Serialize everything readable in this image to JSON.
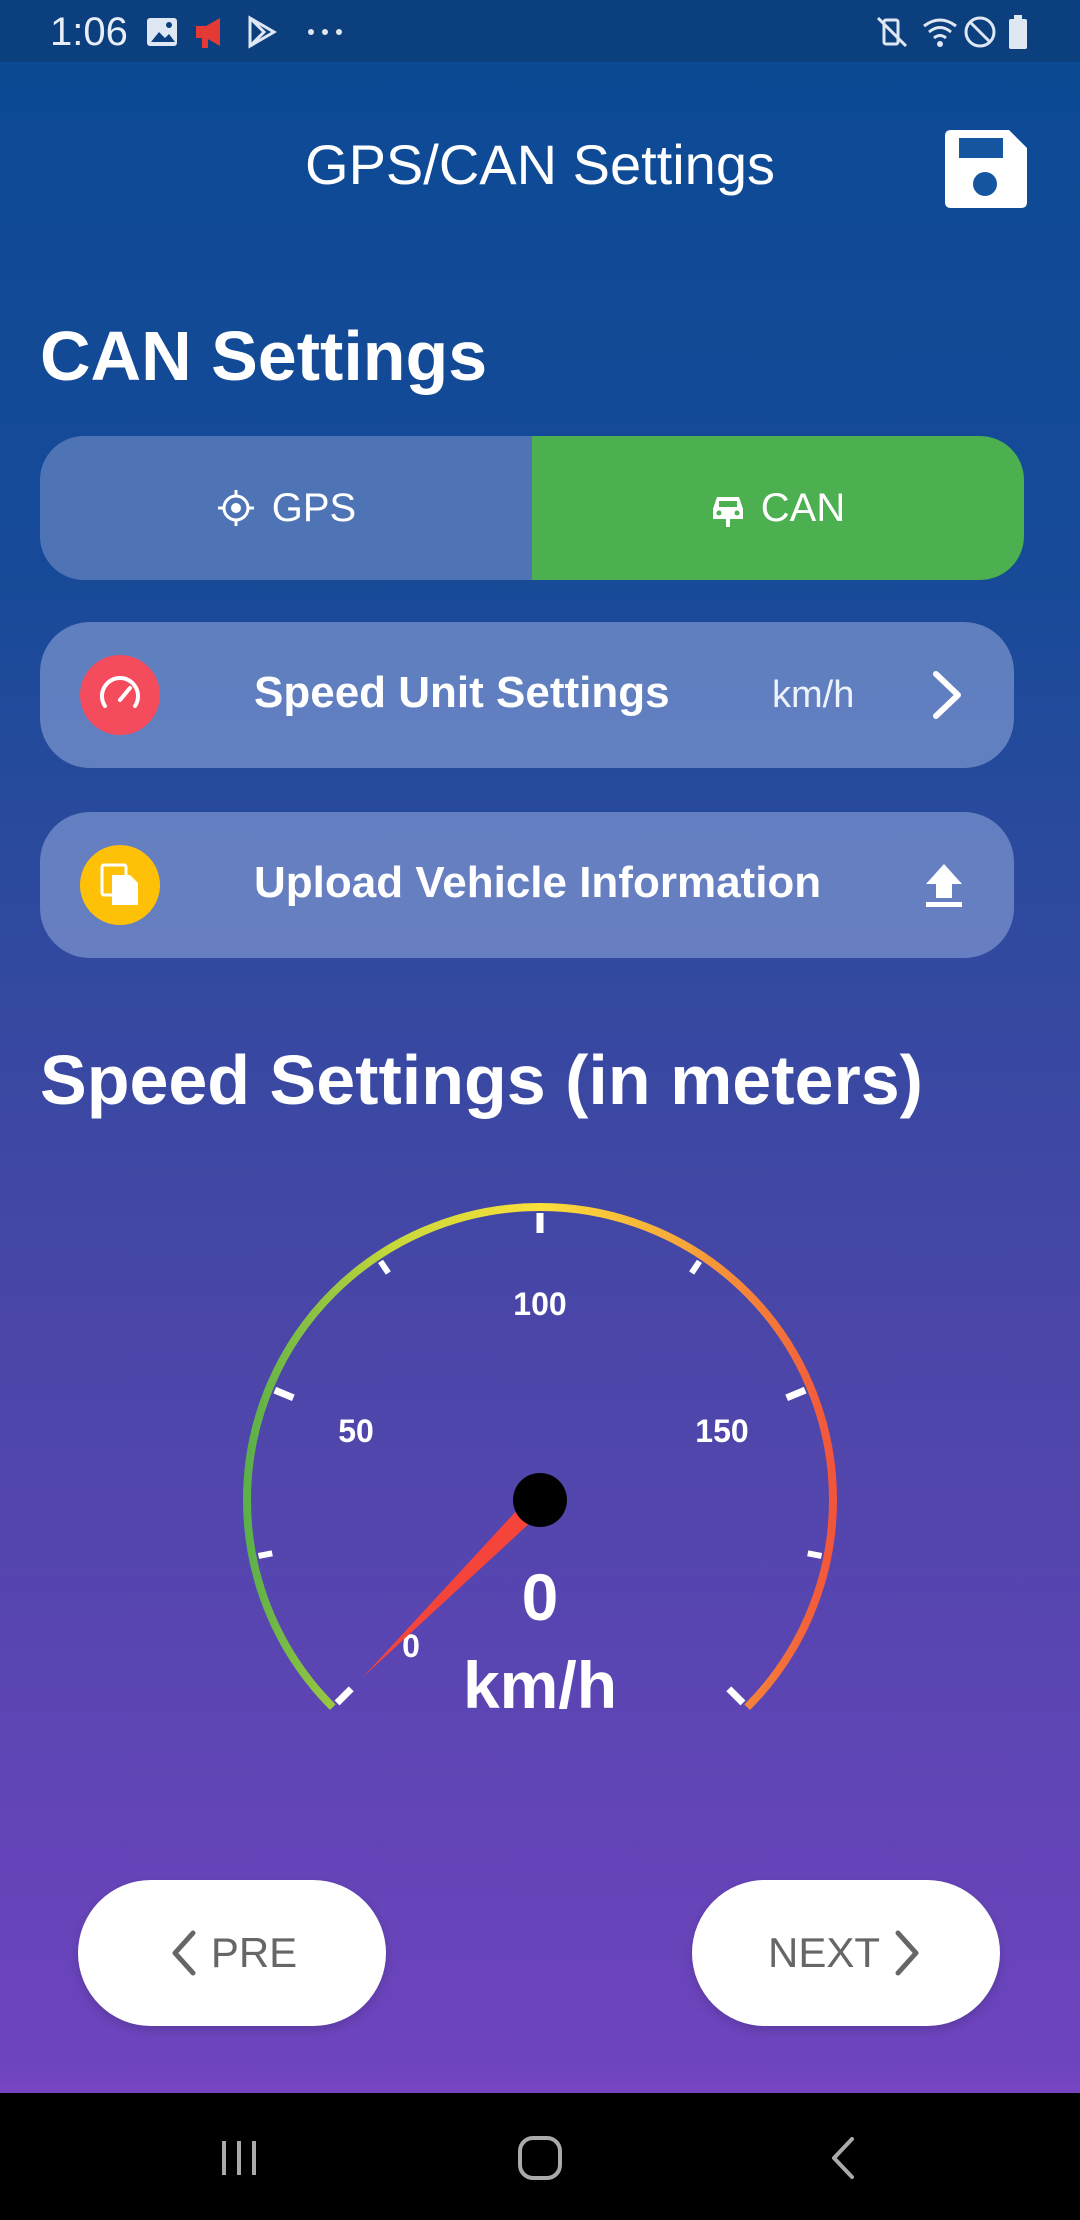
{
  "status_bar": {
    "time": "1:06",
    "left_icons": [
      "gallery-icon",
      "megaphone-icon",
      "play-store-icon",
      "more-dots-icon"
    ],
    "right_icons": [
      "vibrate-mute-icon",
      "wifi-icon",
      "dnd-icon",
      "battery-icon"
    ]
  },
  "appbar": {
    "title": "GPS/CAN Settings",
    "save_icon": "save-icon"
  },
  "can_section": {
    "title": "CAN Settings"
  },
  "segmented": {
    "gps_label": "GPS",
    "can_label": "CAN",
    "selected": "CAN"
  },
  "speed_unit_card": {
    "label": "Speed Unit Settings",
    "value": "km/h",
    "icon": "speedometer-icon",
    "icon_color": "#f44c5c"
  },
  "upload_card": {
    "label": "Upload Vehicle Information",
    "icon": "document-icon",
    "icon_color": "#ffc107"
  },
  "speed_section": {
    "title": "Speed Settings (in meters)"
  },
  "gauge": {
    "min": 0,
    "max": 200,
    "value": 0,
    "unit": "km/h",
    "value_text": "0",
    "tick_labels": [
      "0",
      "50",
      "100",
      "150"
    ],
    "colors": [
      "#5bb04a",
      "#c7d83a",
      "#fbe03a",
      "#f7a53a",
      "#f2553a"
    ],
    "needle_color": "#f5443a"
  },
  "buttons": {
    "pre_label": "PRE",
    "next_label": "NEXT"
  }
}
